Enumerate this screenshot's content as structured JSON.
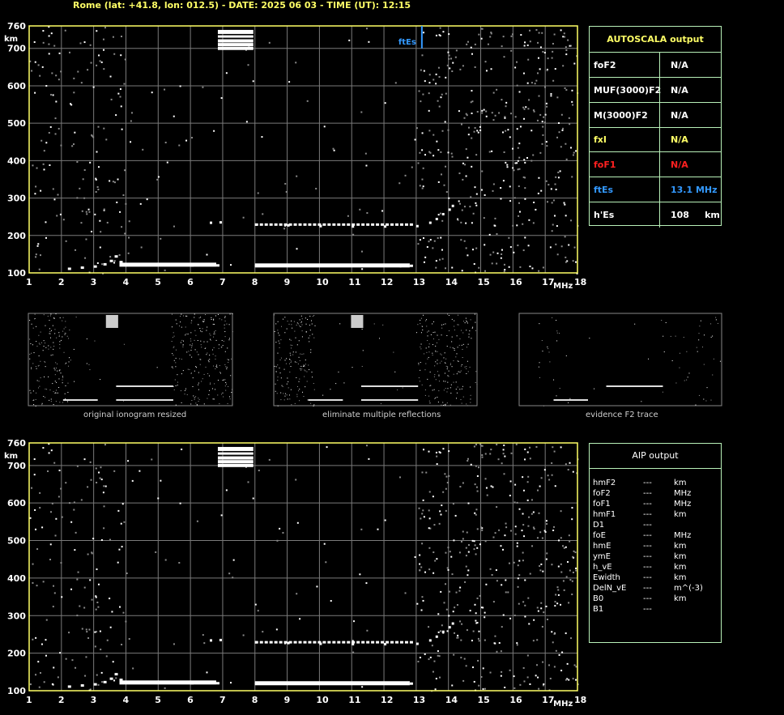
{
  "header": "Rome (lat: +41.8, lon: 012.5) - DATE: 2025 06 03 - TIME (UT): 12:15",
  "chart_data": [
    {
      "type": "scatter",
      "name": "main ionogram",
      "x_unit": "MHz",
      "y_unit": "km",
      "xlim": [
        1,
        18
      ],
      "ylim": [
        100,
        760
      ],
      "x_ticks": [
        1,
        2,
        3,
        4,
        5,
        6,
        7,
        8,
        9,
        10,
        11,
        12,
        13,
        14,
        15,
        16,
        17,
        18
      ],
      "y_ticks": [
        100,
        200,
        300,
        400,
        500,
        600,
        700,
        760
      ],
      "grid": true,
      "annotation": {
        "label": "ftEs",
        "x": 13.1
      },
      "traces": {
        "E_layer": [
          [
            2.2,
            112
          ],
          [
            2.6,
            115
          ],
          [
            3.0,
            118
          ],
          [
            3.3,
            124
          ],
          [
            3.5,
            133
          ],
          [
            3.65,
            145
          ],
          [
            3.8,
            130
          ],
          [
            4.0,
            123
          ],
          [
            5.0,
            122
          ],
          [
            6.0,
            121
          ],
          [
            6.8,
            121
          ],
          [
            8.0,
            120
          ],
          [
            9.0,
            120
          ],
          [
            10.0,
            120
          ],
          [
            11.0,
            120
          ],
          [
            12.0,
            120
          ],
          [
            12.8,
            120
          ]
        ],
        "Es_multiple": [
          [
            6.6,
            235
          ],
          [
            6.9,
            236
          ],
          [
            8.0,
            230
          ],
          [
            9.0,
            228
          ],
          [
            10.0,
            226
          ],
          [
            11.0,
            225
          ],
          [
            12.0,
            225
          ],
          [
            13.0,
            226
          ],
          [
            13.4,
            235
          ],
          [
            13.6,
            245
          ],
          [
            13.8,
            258
          ],
          [
            14.0,
            270
          ],
          [
            14.1,
            280
          ]
        ],
        "block_high": [
          [
            7.0,
            690
          ],
          [
            7.3,
            700
          ],
          [
            7.6,
            710
          ],
          [
            7.9,
            740
          ]
        ]
      }
    },
    {
      "type": "scatter",
      "name": "lower ionogram",
      "x_unit": "MHz",
      "y_unit": "km",
      "xlim": [
        1,
        18
      ],
      "ylim": [
        100,
        760
      ],
      "x_ticks": [
        1,
        2,
        3,
        4,
        5,
        6,
        7,
        8,
        9,
        10,
        11,
        12,
        13,
        14,
        15,
        16,
        17,
        18
      ],
      "y_ticks": [
        100,
        200,
        300,
        400,
        500,
        600,
        700,
        760
      ],
      "grid": true
    }
  ],
  "thumbnails": [
    {
      "caption": "original ionogram resized"
    },
    {
      "caption": "eliminate multiple reflections"
    },
    {
      "caption": "evidence F2 trace"
    }
  ],
  "autoscala": {
    "title": "AUTOSCALA output",
    "rows": [
      {
        "param": "foF2",
        "value": "N/A",
        "color": "#ffffff"
      },
      {
        "param": "MUF(3000)F2",
        "value": "N/A",
        "color": "#ffffff"
      },
      {
        "param": "M(3000)F2",
        "value": "N/A",
        "color": "#ffffff"
      },
      {
        "param": "fxI",
        "value": "N/A",
        "color": "#ffff66"
      },
      {
        "param": "foF1",
        "value": "N/A",
        "color": "#ff2020"
      },
      {
        "param": "ftEs",
        "value": "13.1 MHz",
        "color": "#3399ff"
      },
      {
        "param": "h'Es",
        "value": "108     km",
        "color": "#ffffff"
      }
    ],
    "title_color": "#ffff66"
  },
  "aip": {
    "title": "AIP output",
    "rows": [
      {
        "param": "hmF2",
        "value": "---",
        "unit": "km"
      },
      {
        "param": "foF2",
        "value": "---",
        "unit": "MHz"
      },
      {
        "param": "foF1",
        "value": "---",
        "unit": "MHz"
      },
      {
        "param": "hmF1",
        "value": "---",
        "unit": "km"
      },
      {
        "param": "D1",
        "value": "---",
        "unit": ""
      },
      {
        "param": "foE",
        "value": "---",
        "unit": "MHz"
      },
      {
        "param": "hmE",
        "value": "---",
        "unit": "km"
      },
      {
        "param": "ymE",
        "value": "---",
        "unit": "km"
      },
      {
        "param": "h_vE",
        "value": "---",
        "unit": "km"
      },
      {
        "param": "Ewidth",
        "value": "---",
        "unit": "km"
      },
      {
        "param": "DelN_vE",
        "value": "---",
        "unit": "m^(-3)"
      },
      {
        "param": "B0",
        "value": "---",
        "unit": "km"
      },
      {
        "param": "B1",
        "value": "---",
        "unit": ""
      }
    ]
  },
  "colors": {
    "frame": "#ffff66",
    "grid": "#7a7a7a",
    "table_border": "#b8f0b8",
    "ftEs_marker": "#3399ff"
  }
}
